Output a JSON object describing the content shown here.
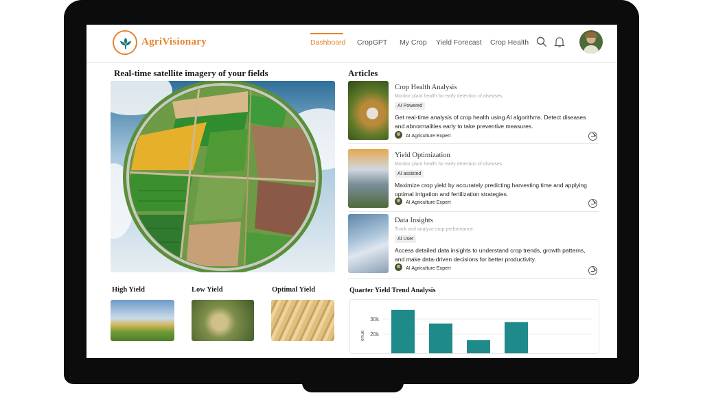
{
  "brand": {
    "name": "AgriVisionary"
  },
  "nav": {
    "items": [
      "Dashboard",
      "CropGPT",
      "My Crop",
      "Yield Forecast",
      "Crop Health"
    ],
    "active": "Dashboard"
  },
  "icons": {
    "search": "search-icon",
    "notifications": "bell-icon",
    "profile": "avatar",
    "open_article": "arrow-down-right-icon"
  },
  "colors": {
    "accent": "#e6822e",
    "bar": "#1f8a8a",
    "logo_leaf": "#1e7a78"
  },
  "satellite": {
    "title": "Real-time satellite imagery of your fields"
  },
  "yield_cards": [
    {
      "label": "High Yield"
    },
    {
      "label": "Low Yield"
    },
    {
      "label": "Optimal Yield"
    }
  ],
  "articles": {
    "title": "Articles",
    "items": [
      {
        "title": "Crop Health Analysis",
        "subtitle": "Monitor plant health for early detection of diseases.",
        "tag": "AI Powered",
        "description": "Get real-time analysis of crop health using AI algorithms. Detect diseases and abnormalities early to take preventive measures.",
        "author": "AI Agriculture Expert"
      },
      {
        "title": "Yield Optimization",
        "subtitle": "Monitor plant health for early detection of diseases.",
        "tag": "AI assisted",
        "description": "Maximize crop yield by accurately predicting harvesting time and applying optimal irrigation and fertilization strategies.",
        "author": "AI Agriculture Expert"
      },
      {
        "title": "Data Insights",
        "subtitle": "Track and analyze crop performance.",
        "tag": "AI User",
        "description": "Access detailed data insights to understand crop trends, growth patterns, and make data-driven decisions for better productivity.",
        "author": "AI Agriculture Expert"
      }
    ]
  },
  "chart": {
    "title": "Quarter Yield Trend Analysis"
  },
  "chart_data": {
    "type": "bar",
    "categories": [
      "",
      "",
      "",
      ""
    ],
    "values": [
      36000,
      27000,
      16000,
      28000
    ],
    "ylabel": "enue",
    "yticks": [
      20000,
      30000
    ],
    "ytick_labels": [
      "20k",
      "30k"
    ],
    "grid": true
  }
}
